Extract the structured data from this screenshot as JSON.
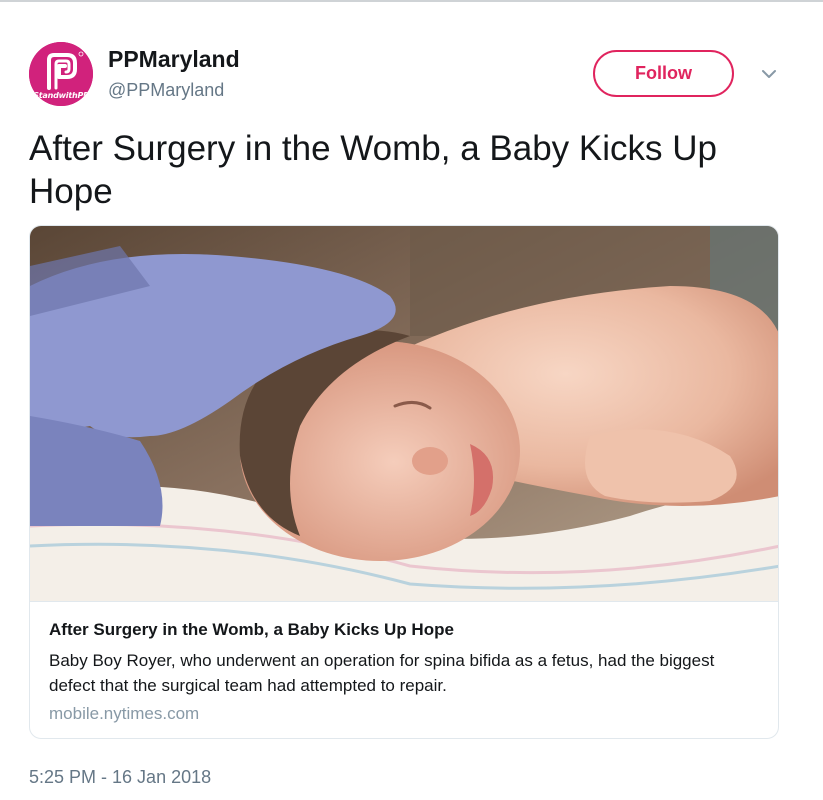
{
  "account": {
    "name": "PPMaryland",
    "handle": "@PPMaryland",
    "avatar_text": "StandwithPP",
    "brand_color": "#d1227c"
  },
  "follow_button": {
    "label": "Follow",
    "color": "#e0245e"
  },
  "menu_icon": "chevron-down-icon",
  "tweet": {
    "text": "After Surgery in the Womb, a Baby Kicks Up Hope",
    "timestamp": "5:25 PM - 16 Jan 2018"
  },
  "card": {
    "image_icon": "newborn-baby-photo",
    "title": "After Surgery in the Womb, a Baby Kicks Up Hope",
    "description": "Baby Boy Royer, who underwent an operation for spina bifida as a fetus, had the biggest defect that the surgical team had attempted to repair.",
    "domain": "mobile.nytimes.com"
  }
}
